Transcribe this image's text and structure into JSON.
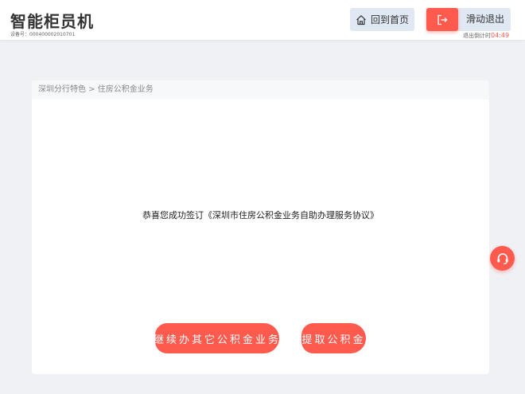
{
  "header": {
    "app_title": "智能柜员机",
    "device_no": "设备号：000400002010701",
    "home_label": "回到首页",
    "exit_label": "滑动退出",
    "countdown_label": "退出倒计时",
    "countdown_time": "04:49"
  },
  "card": {
    "breadcrumb": "深圳分行特色 > 住房公积金业务",
    "message": "恭喜您成功签订《深圳市住房公积金业务自助办理服务协议》",
    "continue_label": "继续办其它公积金业务",
    "withdraw_label": "提取公积金"
  },
  "icons": {
    "home": "home-icon",
    "exit": "exit-icon",
    "support": "headset-icon"
  },
  "colors": {
    "accent": "#ff5a4e",
    "button_bg": "#dfe8f3",
    "page_bg": "#f0f1f5"
  }
}
